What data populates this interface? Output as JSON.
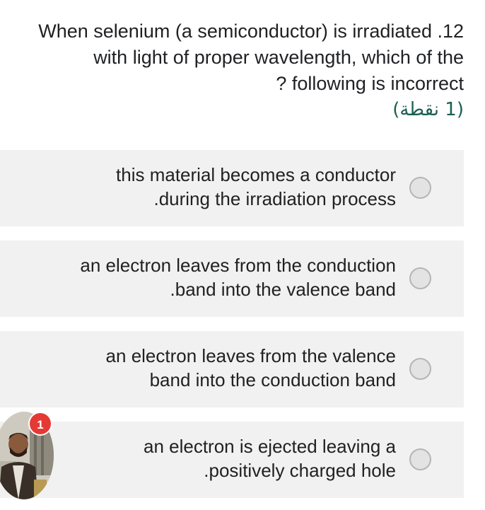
{
  "question": {
    "lines": [
      "When selenium (a semiconductor) is irradiated .12",
      "with light of proper wavelength, which of the",
      "? following is incorrect"
    ],
    "points": "(1 نقطة)"
  },
  "options": [
    {
      "lines": [
        "this material becomes a conductor",
        ".during the irradiation process"
      ],
      "selected": false
    },
    {
      "lines": [
        "an electron leaves from the conduction",
        ".band into the valence band"
      ],
      "selected": false
    },
    {
      "lines": [
        "an electron leaves from the valence",
        "band into the conduction band"
      ],
      "selected": false
    },
    {
      "lines": [
        "an electron is ejected leaving a",
        ".positively charged hole"
      ],
      "selected": false
    }
  ],
  "chat_head": {
    "badge_count": "1"
  },
  "colors": {
    "option_bg": "#f1f1f1",
    "points_text": "#1b5e52",
    "badge": "#e53935"
  }
}
